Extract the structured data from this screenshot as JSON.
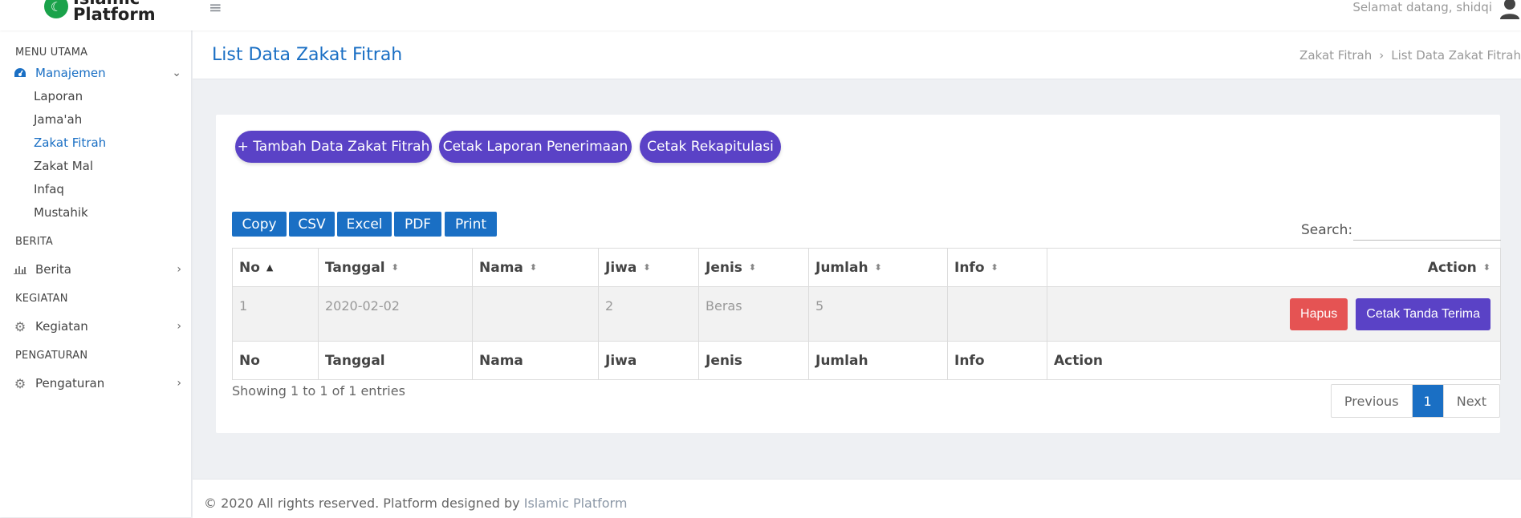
{
  "topbar": {
    "logo_text_line1": "Islamic",
    "logo_text_line2": "Platform",
    "welcome": "Selamat datang, shidqi"
  },
  "sidebar": {
    "sections": [
      "MENU UTAMA",
      "BERITA",
      "KEGIATAN",
      "PENGATURAN"
    ],
    "manajemen": {
      "label": "Manajemen",
      "icon": "dashboard-icon",
      "subitems": [
        "Laporan",
        "Jama'ah",
        "Zakat Fitrah",
        "Zakat Mal",
        "Infaq",
        "Mustahik"
      ]
    },
    "berita": {
      "label": "Berita",
      "icon": "bar-chart-icon"
    },
    "kegiatan": {
      "label": "Kegiatan",
      "icon": "gear-icon"
    },
    "pengaturan": {
      "label": "Pengaturan",
      "icon": "gear-icon"
    }
  },
  "header": {
    "title": "List Data Zakat Fitrah",
    "breadcrumb": [
      "Zakat Fitrah",
      "List Data Zakat Fitrah"
    ]
  },
  "actions": {
    "tambah": "+ Tambah Data Zakat Fitrah",
    "cetak_laporan": "Cetak Laporan Penerimaan",
    "cetak_rekap": "Cetak Rekapitulasi"
  },
  "export_buttons": [
    "Copy",
    "CSV",
    "Excel",
    "PDF",
    "Print"
  ],
  "search": {
    "label": "Search:",
    "value": ""
  },
  "table": {
    "columns": [
      "No",
      "Tanggal",
      "Nama",
      "Jiwa",
      "Jenis",
      "Jumlah",
      "Info",
      "Action"
    ],
    "rows": [
      {
        "no": "1",
        "tanggal": "2020-02-02",
        "nama": "",
        "jiwa": "2",
        "jenis": "Beras",
        "jumlah": "5",
        "info": ""
      }
    ],
    "row_actions": {
      "hapus": "Hapus",
      "cetak": "Cetak Tanda Terima"
    }
  },
  "pagination": {
    "info": "Showing 1 to 1 of 1 entries",
    "previous": "Previous",
    "current": "1",
    "next": "Next"
  },
  "footer": {
    "text": "© 2020 All rights reserved. Platform designed by ",
    "link": "Islamic Platform"
  },
  "colors": {
    "primary": "#1a6fc4",
    "accent": "#5a42c6",
    "danger": "#e55353",
    "logo_green": "#1aa24a"
  }
}
